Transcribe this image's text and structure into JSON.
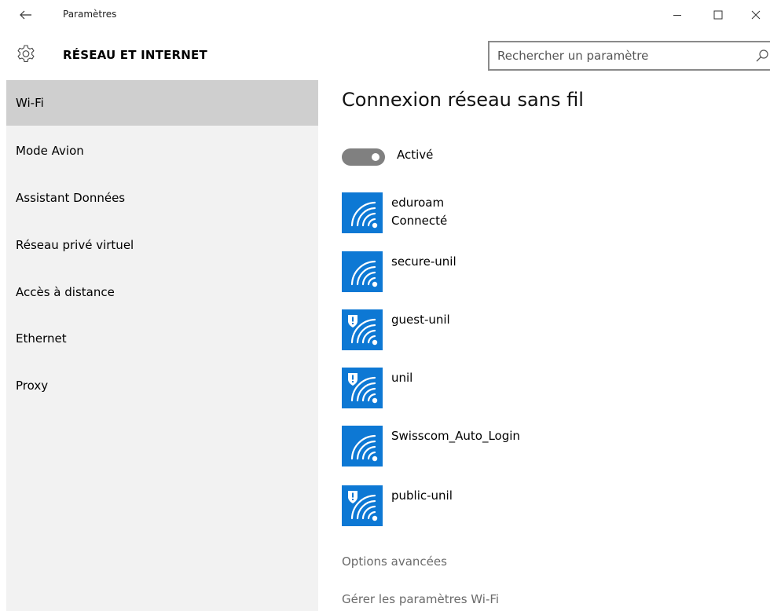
{
  "window": {
    "title": "Paramètres"
  },
  "header": {
    "section_title": "RÉSEAU ET INTERNET",
    "search_placeholder": "Rechercher un paramètre"
  },
  "sidebar": {
    "items": [
      {
        "label": "Wi-Fi",
        "active": true
      },
      {
        "label": "Mode Avion",
        "active": false
      },
      {
        "label": "Assistant Données",
        "active": false
      },
      {
        "label": "Réseau privé virtuel",
        "active": false
      },
      {
        "label": "Accès à distance",
        "active": false
      },
      {
        "label": "Ethernet",
        "active": false
      },
      {
        "label": "Proxy",
        "active": false
      }
    ]
  },
  "main": {
    "title": "Connexion réseau sans fil",
    "toggle": {
      "label": "Activé",
      "on": true
    },
    "networks": [
      {
        "name": "eduroam",
        "status": "Connecté",
        "secured": false,
        "icon": "wifi-icon"
      },
      {
        "name": "secure-unil",
        "status": "",
        "secured": false,
        "icon": "wifi-icon"
      },
      {
        "name": "guest-unil",
        "status": "",
        "secured": true,
        "icon": "wifi-shield-icon"
      },
      {
        "name": "unil",
        "status": "",
        "secured": true,
        "icon": "wifi-shield-icon"
      },
      {
        "name": "Swisscom_Auto_Login",
        "status": "",
        "secured": false,
        "icon": "wifi-icon"
      },
      {
        "name": "public-unil",
        "status": "",
        "secured": true,
        "icon": "wifi-shield-icon"
      }
    ],
    "links": {
      "advanced": "Options avancées",
      "manage": "Gérer les paramètres Wi-Fi"
    }
  },
  "colors": {
    "accent": "#0d78d4",
    "sidebar_bg": "#f2f2f2",
    "sidebar_active": "#cfcfcf",
    "toggle": "#808080",
    "link": "#6b6b6b"
  }
}
